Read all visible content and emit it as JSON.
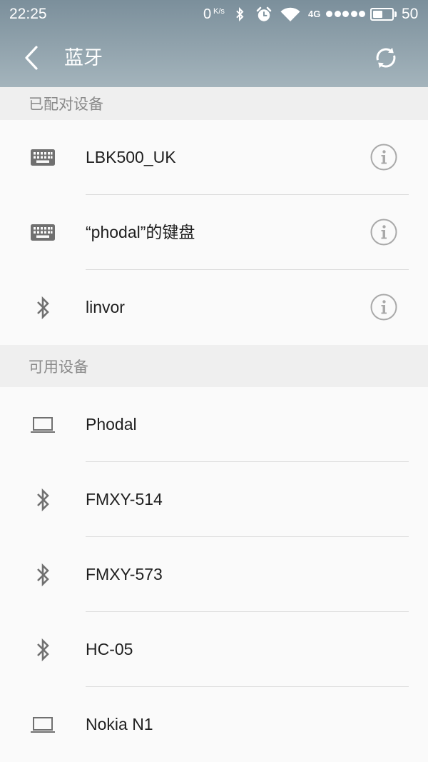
{
  "status_bar": {
    "time": "22:25",
    "net_speed": {
      "value": "0",
      "unit": "K/s"
    },
    "network_type": "4G",
    "signal_level": 5,
    "signal_max": 5,
    "battery_level": "50",
    "icons": {
      "bluetooth": "bluetooth-icon",
      "alarm": "alarm-icon",
      "wifi": "wifi-icon",
      "battery": "battery-icon"
    }
  },
  "app_bar": {
    "title": "蓝牙",
    "back_icon": "back-icon",
    "refresh_icon": "refresh-icon"
  },
  "paired_section": {
    "header": "已配对设备",
    "devices": [
      {
        "name": "LBK500_UK",
        "icon": "keyboard-icon",
        "action_icon": "info-icon"
      },
      {
        "name": "“phodal”的键盘",
        "icon": "keyboard-icon",
        "action_icon": "info-icon"
      },
      {
        "name": "linvor",
        "icon": "bluetooth-icon",
        "action_icon": "info-icon"
      }
    ]
  },
  "available_section": {
    "header": "可用设备",
    "devices": [
      {
        "name": "Phodal",
        "icon": "laptop-icon"
      },
      {
        "name": "FMXY-514",
        "icon": "bluetooth-icon"
      },
      {
        "name": "FMXY-573",
        "icon": "bluetooth-icon"
      },
      {
        "name": "HC-05",
        "icon": "bluetooth-icon"
      },
      {
        "name": "Nokia N1",
        "icon": "laptop-icon"
      }
    ]
  },
  "colors": {
    "header_top": "#7b8f9b",
    "header_bottom": "#a4b4bc",
    "section_bg": "#efefef",
    "list_bg": "#fafafa",
    "section_text": "#8a8a8a",
    "item_text": "#1f1f1f",
    "icon": "#707070",
    "info_icon": "#a9a9a9",
    "divider": "#dcdcdc"
  }
}
